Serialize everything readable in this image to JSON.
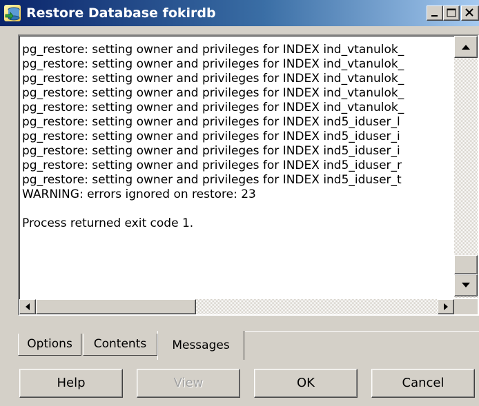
{
  "window": {
    "title": "Restore Database fokirdb",
    "controls": [
      "minimize-icon",
      "maximize-icon",
      "close-icon"
    ]
  },
  "messages": [
    "pg_restore: setting owner and privileges for INDEX ind_vtanulok_",
    "pg_restore: setting owner and privileges for INDEX ind_vtanulok_",
    "pg_restore: setting owner and privileges for INDEX ind_vtanulok_",
    "pg_restore: setting owner and privileges for INDEX ind_vtanulok_",
    "pg_restore: setting owner and privileges for INDEX ind_vtanulok_",
    "pg_restore: setting owner and privileges for INDEX ind5_iduser_l",
    "pg_restore: setting owner and privileges for INDEX ind5_iduser_i",
    "pg_restore: setting owner and privileges for INDEX ind5_iduser_i",
    "pg_restore: setting owner and privileges for INDEX ind5_iduser_r",
    "pg_restore: setting owner and privileges for INDEX ind5_iduser_t",
    "WARNING: errors ignored on restore: 23",
    "",
    "Process returned exit code 1."
  ],
  "tabs": [
    {
      "label": "Options",
      "active": false
    },
    {
      "label": "Contents",
      "active": false
    },
    {
      "label": "Messages",
      "active": true
    }
  ],
  "buttons": {
    "help": {
      "label": "Help",
      "enabled": true
    },
    "view": {
      "label": "View",
      "enabled": false
    },
    "ok": {
      "label": "OK",
      "enabled": true
    },
    "cancel": {
      "label": "Cancel",
      "enabled": true
    }
  },
  "colors": {
    "titlebar_start": "#0a246a",
    "titlebar_end": "#a6caf0",
    "face": "#d4d0c8",
    "disabled_text": "#a0a0a0"
  }
}
